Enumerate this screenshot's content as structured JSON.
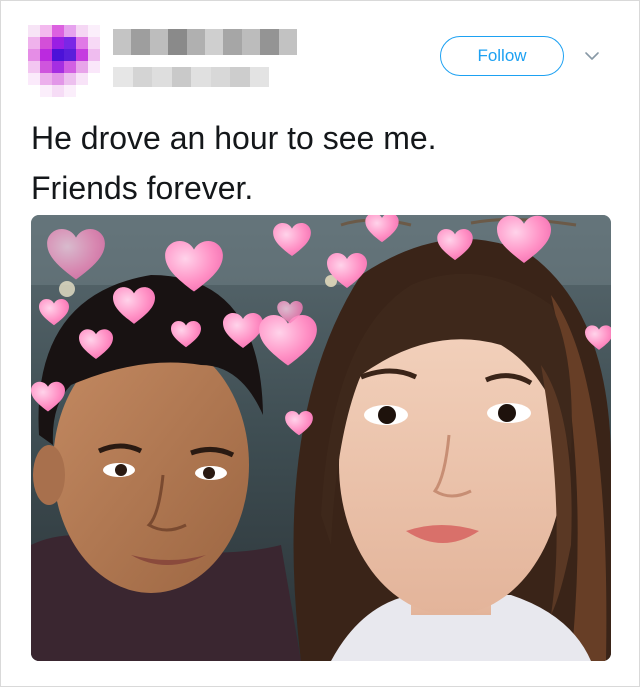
{
  "tweet": {
    "text_lines": [
      "He drove an hour to see me.",
      "Friends forever."
    ],
    "follow_label": "Follow",
    "avatar_pixels": [
      [
        "#f7e4f6",
        "#f3b9ee",
        "#dc61e0",
        "#e6a2ee",
        "#f5d7f4",
        "#fbeffb"
      ],
      [
        "#efb2ec",
        "#d34fd8",
        "#9a1ee3",
        "#7a27e6",
        "#e079e6",
        "#f7d9f6"
      ],
      [
        "#e58de6",
        "#bb2adf",
        "#4b12d8",
        "#5a1edb",
        "#c53ce0",
        "#efbcef"
      ],
      [
        "#f3c6f1",
        "#cf55dd",
        "#a52ee2",
        "#d25fe3",
        "#e8a4ea",
        "#fae7fa"
      ],
      [
        "#fbeafb",
        "#ecb0ec",
        "#e296e8",
        "#edc0ef",
        "#f8e3f8",
        "#ffffff"
      ],
      [
        "#ffffff",
        "#fbeefb",
        "#f6dcf6",
        "#fbeefb",
        "#ffffff",
        "#ffffff"
      ]
    ],
    "name_blur_colors": [
      "#c4c4c4",
      "#9e9e9e",
      "#bdbdbd",
      "#8a8a8a",
      "#b0b0b0",
      "#cfcfcf",
      "#a6a6a6",
      "#bcbcbc",
      "#949494",
      "#c2c2c2"
    ],
    "handle_blur_colors": [
      "#e6e6e6",
      "#d4d4d4",
      "#dedede",
      "#c9c9c9",
      "#e0e0e0",
      "#d8d8d8",
      "#cdcdcd",
      "#e3e3e3"
    ],
    "colors": {
      "accent": "#1da1f2",
      "text": "#14171a",
      "heart": "#ff8fc4"
    },
    "icons": {
      "more": "chevron-down-icon"
    }
  }
}
